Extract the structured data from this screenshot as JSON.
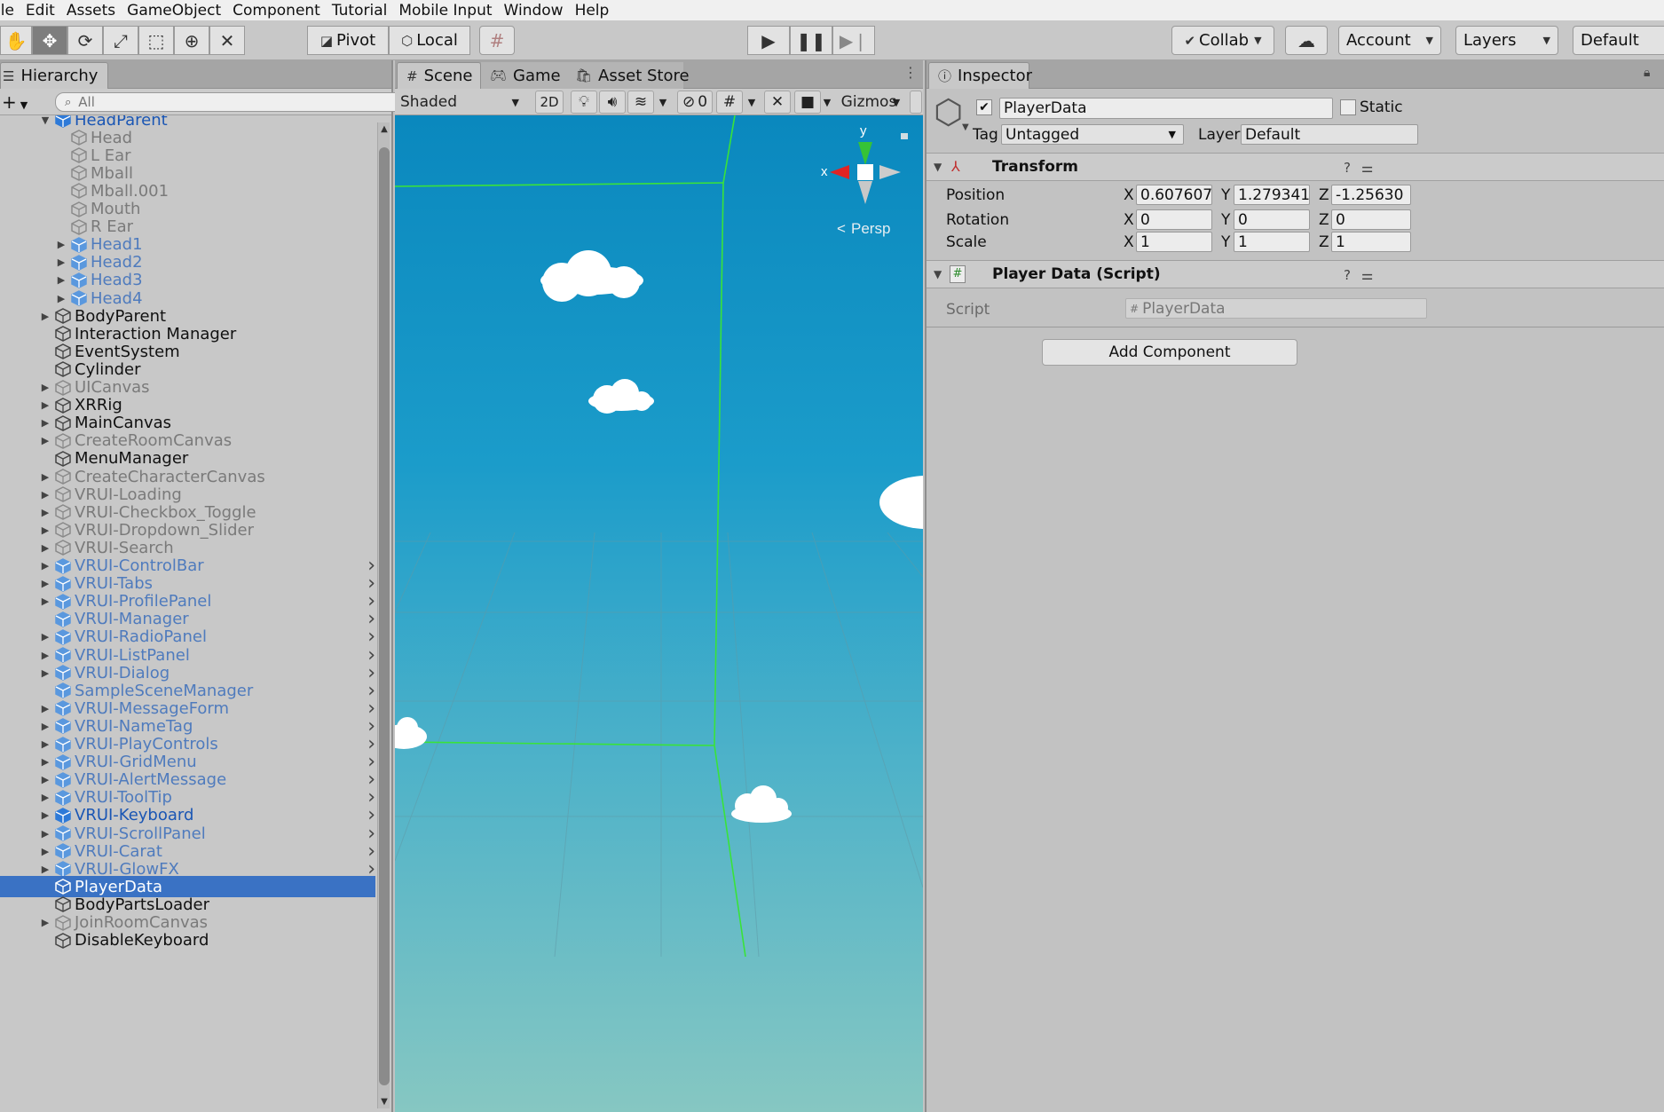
{
  "menu": [
    "ile",
    "Edit",
    "Assets",
    "GameObject",
    "Component",
    "Tutorial",
    "Mobile Input",
    "Window",
    "Help"
  ],
  "toolbar": {
    "pivot_label": "Pivot",
    "local_label": "Local",
    "collab_label": "Collab",
    "account_label": "Account",
    "layers_label": "Layers",
    "layout_label": "Default"
  },
  "hierarchy": {
    "tab_label": "Hierarchy",
    "search_placeholder": "All",
    "rows": [
      {
        "label": "HeadParent",
        "indent": 1,
        "arrow": "open",
        "style": "prefab",
        "more": false
      },
      {
        "label": "Head",
        "indent": 2,
        "arrow": "",
        "style": "inactive",
        "more": false
      },
      {
        "label": "L Ear",
        "indent": 2,
        "arrow": "",
        "style": "inactive",
        "more": false
      },
      {
        "label": "Mball",
        "indent": 2,
        "arrow": "",
        "style": "inactive",
        "more": false
      },
      {
        "label": "Mball.001",
        "indent": 2,
        "arrow": "",
        "style": "inactive",
        "more": false
      },
      {
        "label": "Mouth",
        "indent": 2,
        "arrow": "",
        "style": "inactive",
        "more": false
      },
      {
        "label": "R Ear",
        "indent": 2,
        "arrow": "",
        "style": "inactive",
        "more": false
      },
      {
        "label": "Head1",
        "indent": 2,
        "arrow": "closed",
        "style": "prefab-inactive",
        "more": false
      },
      {
        "label": "Head2",
        "indent": 2,
        "arrow": "closed",
        "style": "prefab-inactive",
        "more": false
      },
      {
        "label": "Head3",
        "indent": 2,
        "arrow": "closed",
        "style": "prefab-inactive",
        "more": false
      },
      {
        "label": "Head4",
        "indent": 2,
        "arrow": "closed",
        "style": "prefab-inactive",
        "more": false
      },
      {
        "label": "BodyParent",
        "indent": 1,
        "arrow": "closed",
        "style": "normal",
        "more": false
      },
      {
        "label": "Interaction Manager",
        "indent": 1,
        "arrow": "",
        "style": "normal",
        "more": false
      },
      {
        "label": "EventSystem",
        "indent": 1,
        "arrow": "",
        "style": "normal",
        "more": false
      },
      {
        "label": "Cylinder",
        "indent": 1,
        "arrow": "",
        "style": "normal",
        "more": false
      },
      {
        "label": "UICanvas",
        "indent": 1,
        "arrow": "closed",
        "style": "inactive",
        "more": false
      },
      {
        "label": "XRRig",
        "indent": 1,
        "arrow": "closed",
        "style": "normal",
        "more": false
      },
      {
        "label": "MainCanvas",
        "indent": 1,
        "arrow": "closed",
        "style": "normal",
        "more": false
      },
      {
        "label": "CreateRoomCanvas",
        "indent": 1,
        "arrow": "closed",
        "style": "inactive",
        "more": false
      },
      {
        "label": "MenuManager",
        "indent": 1,
        "arrow": "",
        "style": "normal",
        "more": false
      },
      {
        "label": "CreateCharacterCanvas",
        "indent": 1,
        "arrow": "closed",
        "style": "inactive",
        "more": false
      },
      {
        "label": "VRUI-Loading",
        "indent": 1,
        "arrow": "closed",
        "style": "inactive",
        "more": false
      },
      {
        "label": "VRUI-Checkbox_Toggle",
        "indent": 1,
        "arrow": "closed",
        "style": "inactive",
        "more": false
      },
      {
        "label": "VRUI-Dropdown_Slider",
        "indent": 1,
        "arrow": "closed",
        "style": "inactive",
        "more": false
      },
      {
        "label": "VRUI-Search",
        "indent": 1,
        "arrow": "closed",
        "style": "inactive",
        "more": false
      },
      {
        "label": "VRUI-ControlBar",
        "indent": 1,
        "arrow": "closed",
        "style": "prefab-inactive",
        "more": true
      },
      {
        "label": "VRUI-Tabs",
        "indent": 1,
        "arrow": "closed",
        "style": "prefab-inactive",
        "more": true
      },
      {
        "label": "VRUI-ProfilePanel",
        "indent": 1,
        "arrow": "closed",
        "style": "prefab-inactive",
        "more": true
      },
      {
        "label": "VRUI-Manager",
        "indent": 1,
        "arrow": "",
        "style": "prefab-inactive",
        "more": true
      },
      {
        "label": "VRUI-RadioPanel",
        "indent": 1,
        "arrow": "closed",
        "style": "prefab-inactive",
        "more": true
      },
      {
        "label": "VRUI-ListPanel",
        "indent": 1,
        "arrow": "closed",
        "style": "prefab-inactive",
        "more": true
      },
      {
        "label": "VRUI-Dialog",
        "indent": 1,
        "arrow": "closed",
        "style": "prefab-inactive",
        "more": true
      },
      {
        "label": "SampleSceneManager",
        "indent": 1,
        "arrow": "",
        "style": "prefab-inactive",
        "more": true
      },
      {
        "label": "VRUI-MessageForm",
        "indent": 1,
        "arrow": "closed",
        "style": "prefab-inactive",
        "more": true
      },
      {
        "label": "VRUI-NameTag",
        "indent": 1,
        "arrow": "closed",
        "style": "prefab-inactive",
        "more": true
      },
      {
        "label": "VRUI-PlayControls",
        "indent": 1,
        "arrow": "closed",
        "style": "prefab-inactive",
        "more": true
      },
      {
        "label": "VRUI-GridMenu",
        "indent": 1,
        "arrow": "closed",
        "style": "prefab-inactive",
        "more": true
      },
      {
        "label": "VRUI-AlertMessage",
        "indent": 1,
        "arrow": "closed",
        "style": "prefab-inactive",
        "more": true
      },
      {
        "label": "VRUI-ToolTip",
        "indent": 1,
        "arrow": "closed",
        "style": "prefab-inactive",
        "more": true
      },
      {
        "label": "VRUI-Keyboard",
        "indent": 1,
        "arrow": "closed",
        "style": "prefab",
        "more": true
      },
      {
        "label": "VRUI-ScrollPanel",
        "indent": 1,
        "arrow": "closed",
        "style": "prefab-inactive",
        "more": true
      },
      {
        "label": "VRUI-Carat",
        "indent": 1,
        "arrow": "closed",
        "style": "prefab-inactive",
        "more": true
      },
      {
        "label": "VRUI-GlowFX",
        "indent": 1,
        "arrow": "closed",
        "style": "prefab-inactive",
        "more": true
      },
      {
        "label": "PlayerData",
        "indent": 1,
        "arrow": "",
        "style": "normal",
        "more": false,
        "selected": true
      },
      {
        "label": "BodyPartsLoader",
        "indent": 1,
        "arrow": "",
        "style": "normal",
        "more": false
      },
      {
        "label": "JoinRoomCanvas",
        "indent": 1,
        "arrow": "closed",
        "style": "inactive",
        "more": false
      },
      {
        "label": "DisableKeyboard",
        "indent": 1,
        "arrow": "",
        "style": "normal",
        "more": false
      }
    ]
  },
  "scene": {
    "tabs": [
      "Scene",
      "Game",
      "Asset Store"
    ],
    "shading_mode": "Shaded",
    "mode_2d": "2D",
    "hidden_count": "0",
    "gizmos_label": "Gizmos",
    "gizmo_y": "y",
    "gizmo_x": "x",
    "projection_label": "Persp"
  },
  "inspector": {
    "tab_label": "Inspector",
    "object_name": "PlayerData",
    "static_label": "Static",
    "tag_label": "Tag",
    "tag_value": "Untagged",
    "layer_label": "Layer",
    "layer_value": "Default",
    "transform": {
      "title": "Transform",
      "position_label": "Position",
      "rotation_label": "Rotation",
      "scale_label": "Scale",
      "axis_x": "X",
      "axis_y": "Y",
      "axis_z": "Z",
      "position": {
        "x": "0.6076075",
        "y": "1.279341",
        "z": "-1.25630"
      },
      "rotation": {
        "x": "0",
        "y": "0",
        "z": "0"
      },
      "scale": {
        "x": "1",
        "y": "1",
        "z": "1"
      }
    },
    "script_component": {
      "title": "Player Data (Script)",
      "script_label": "Script",
      "script_value": "PlayerData"
    },
    "add_component_label": "Add Component"
  }
}
